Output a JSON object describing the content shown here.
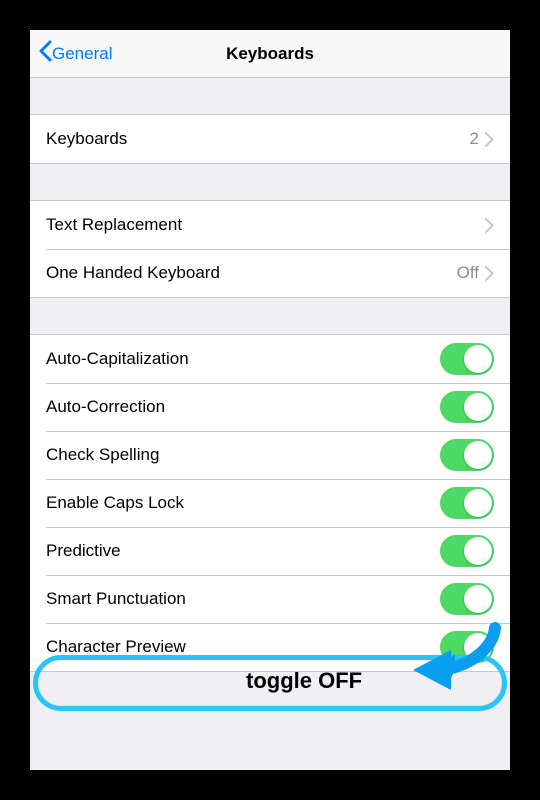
{
  "nav": {
    "back_label": "General",
    "title": "Keyboards"
  },
  "section_keyboards": {
    "label": "Keyboards",
    "value": "2"
  },
  "section_text": {
    "text_replacement": "Text Replacement",
    "one_handed": {
      "label": "One Handed Keyboard",
      "value": "Off"
    }
  },
  "toggles": {
    "auto_capitalization": "Auto-Capitalization",
    "auto_correction": "Auto-Correction",
    "check_spelling": "Check Spelling",
    "enable_caps_lock": "Enable Caps Lock",
    "predictive": "Predictive",
    "smart_punctuation": "Smart Punctuation",
    "character_preview": "Character Preview"
  },
  "annotation": {
    "label": "toggle OFF"
  }
}
